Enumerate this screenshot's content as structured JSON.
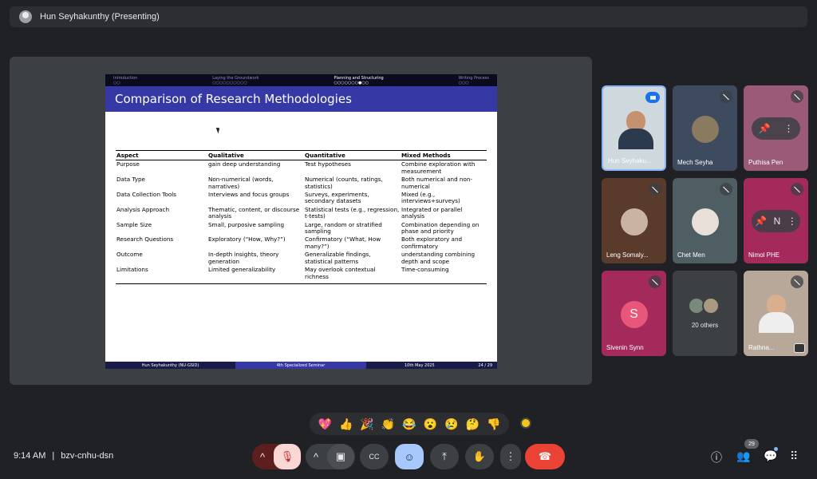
{
  "presenter_bar": {
    "name": "Hun Seyhakunthy (Presenting)"
  },
  "slide": {
    "nav": [
      {
        "label": "Introduction",
        "dots": "○○",
        "active": false
      },
      {
        "label": "Laying the Groundwork",
        "dots": "○○○○○○○○○○",
        "active": false
      },
      {
        "label": "Planning and Structuring",
        "dots": "○○○○○○○●○○",
        "active": true
      },
      {
        "label": "Writing Process",
        "dots": "○○○",
        "active": false
      }
    ],
    "title": "Comparison of Research Methodologies",
    "table": {
      "headers": [
        "Aspect",
        "Qualitative",
        "Quantitative",
        "Mixed Methods"
      ],
      "rows": [
        [
          "Purpose",
          "gain deep understanding",
          "Test hypotheses",
          "Combine exploration with measurement"
        ],
        [
          "Data Type",
          "Non-numerical (words, narratives)",
          "Numerical (counts, ratings, statistics)",
          "Both numerical and non-numerical"
        ],
        [
          "Data Collection Tools",
          "Interviews and focus groups",
          "Surveys, experiments, secondary datasets",
          "Mixed (e.g., interviews+surveys)"
        ],
        [
          "Analysis Approach",
          "Thematic, content, or discourse analysis",
          "Statistical tests (e.g., regression, t-tests)",
          "Integrated or parallel analysis"
        ],
        [
          "Sample Size",
          "Small, purposive sampling",
          "Large, random or stratified sampling",
          "Combination depending on phase and priority"
        ],
        [
          "Research Questions",
          "Exploratory (“How, Why?”)",
          "Confirmatory (“What, How many?”)",
          "Both exploratory and confirmatory"
        ],
        [
          "Outcome",
          "In-depth insights, theory generation",
          "Generalizable findings, statistical patterns",
          "understanding combining depth and scope"
        ],
        [
          "Limitations",
          "Limited generalizability",
          "May overlook contextual richness",
          "Time-consuming"
        ]
      ]
    },
    "footer": {
      "author": "Hun Seyhakunthy (NU-GSID)",
      "event": "4th Specialized Seminar",
      "date": "10th May 2025",
      "page": "24 / 29"
    }
  },
  "participants": [
    {
      "name": "Hun Seyhaku...",
      "mic": "speaking",
      "bg": "#cfd8dc"
    },
    {
      "name": "Mech Seyha",
      "mic": "off",
      "bg": "#3e4a5e"
    },
    {
      "name": "Puthisa Pen",
      "mic": "off",
      "bg": "#9a5a78"
    },
    {
      "name": "Leng Somaly...",
      "mic": "off",
      "bg": "#5a3a2a"
    },
    {
      "name": "Chet Men",
      "mic": "off",
      "bg": "#4f5e63"
    },
    {
      "name": "Nimol PHE",
      "mic": "off",
      "bg": "#a52a5c",
      "initial": "N"
    },
    {
      "name": "Sivenin Synn",
      "mic": "off",
      "bg": "#a52a5c",
      "initial": "S",
      "avatar_color": "#e8567a"
    },
    {
      "name": "Rathna...",
      "mic": "off",
      "bg": "#b8a89a"
    }
  ],
  "others": {
    "label": "20 others"
  },
  "reactions": [
    "💖",
    "👍",
    "🎉",
    "👏",
    "😂",
    "😮",
    "😢",
    "🤔",
    "👎"
  ],
  "meeting": {
    "time": "9:14 AM",
    "separator": "|",
    "code": "bzv-cnhu-dsn"
  },
  "people_count": "29",
  "controls": {
    "chevron_up": "^",
    "mic_off": "🎙",
    "camera": "▣",
    "captions": "CC",
    "emoji": "☺",
    "present": "⤒",
    "hand": "✋",
    "more": "⋮",
    "end_call": "☎",
    "info": "ⓘ",
    "people": "👥",
    "chat": "💬",
    "apps": "⠿"
  },
  "icons": {
    "pin": "📌",
    "more_vert": "⋮",
    "mic_speaking": "▮▮▮"
  }
}
